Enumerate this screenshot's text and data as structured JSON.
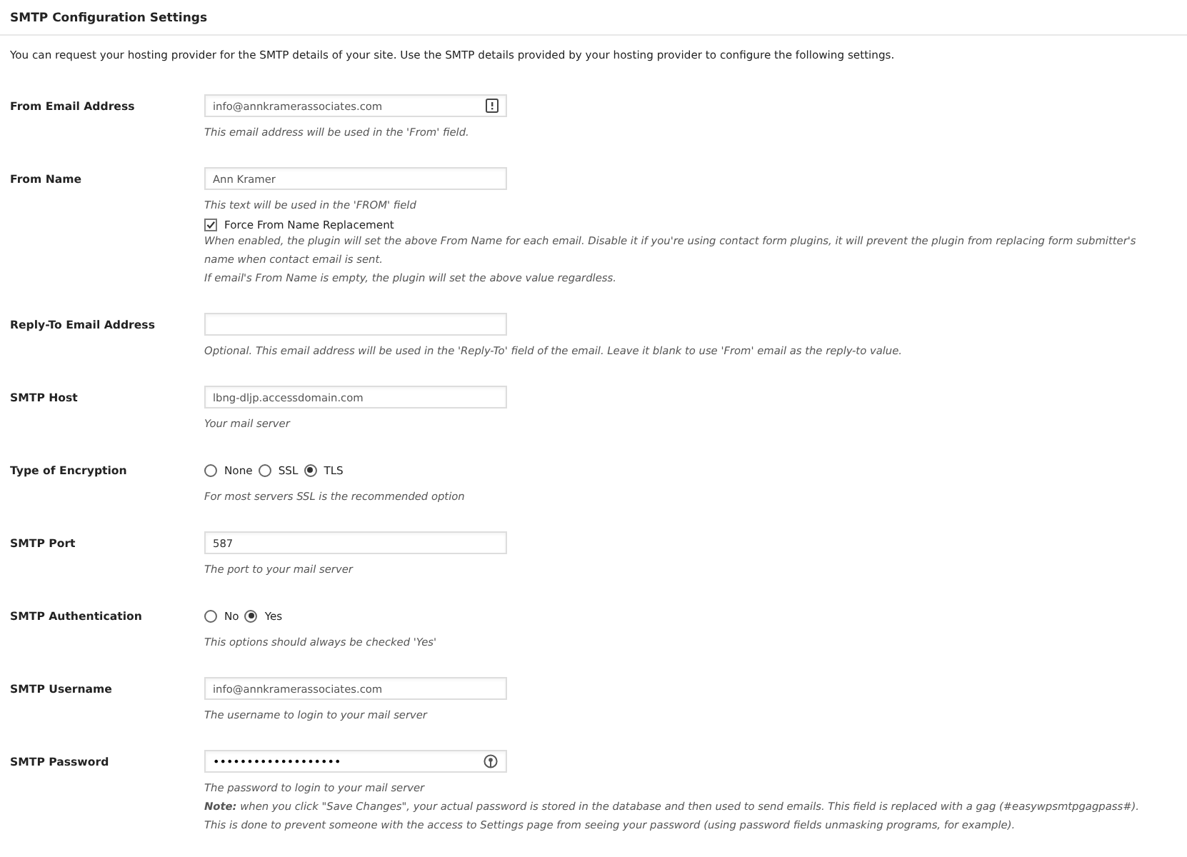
{
  "title": "SMTP Configuration Settings",
  "intro": "You can request your hosting provider for the SMTP details of your site. Use the SMTP details provided by your hosting provider to configure the following settings.",
  "fields": [
    {
      "label": "From Email Address",
      "kind": "email",
      "value": "info@annkramerassociates.com",
      "description": "This email address will be used in the 'From' field."
    },
    {
      "label": "From Name",
      "kind": "text",
      "value": "Ann Kramer",
      "description": "This text will be used in the 'FROM' field",
      "checkbox": {
        "label": "Force From Name Replacement",
        "checked": true
      },
      "notes": [
        "When enabled, the plugin will set the above From Name for each email. Disable it if you're using contact form plugins, it will prevent the plugin from replacing form submitter's name when contact email is sent.",
        "If email's From Name is empty, the plugin will set the above value regardless."
      ]
    },
    {
      "label": "Reply-To Email Address",
      "kind": "text",
      "description": "Optional. This email address will be used in the 'Reply-To' field of the email. Leave it blank to use 'From' email as the reply-to value."
    },
    {
      "label": "SMTP Host",
      "kind": "text",
      "value": "lbng-dljp.accessdomain.com",
      "description": "Your mail server"
    },
    {
      "label": "Type of Encryption",
      "kind": "radio",
      "options": [
        {
          "label": "None",
          "selected": false
        },
        {
          "label": "SSL",
          "selected": false
        },
        {
          "label": "TLS",
          "selected": true
        }
      ],
      "description": "For most servers SSL is the recommended option"
    },
    {
      "label": "SMTP Port",
      "kind": "text",
      "value": "587",
      "description": "The port to your mail server"
    },
    {
      "label": "SMTP Authentication",
      "kind": "radio",
      "options": [
        {
          "label": "No",
          "selected": false
        },
        {
          "label": "Yes",
          "selected": true
        }
      ],
      "description": "This options should always be checked 'Yes'"
    },
    {
      "label": "SMTP Username",
      "kind": "text",
      "value": "info@annkramerassociates.com",
      "description": "The username to login to your mail server"
    },
    {
      "label": "SMTP Password",
      "kind": "password",
      "value": "•••••••••••••••••••",
      "description": "The password to login to your mail server",
      "notes": [
        "**Note:** *when you click \"Save Changes\", your actual password is stored in the database and then used to send emails. This field is replaced with a gag (#easywpsmtpgagpass#).*",
        "This is done to prevent someone with the access to Settings page from seeing your password (using password fields unmasking programs, for example)."
      ]
    }
  ]
}
